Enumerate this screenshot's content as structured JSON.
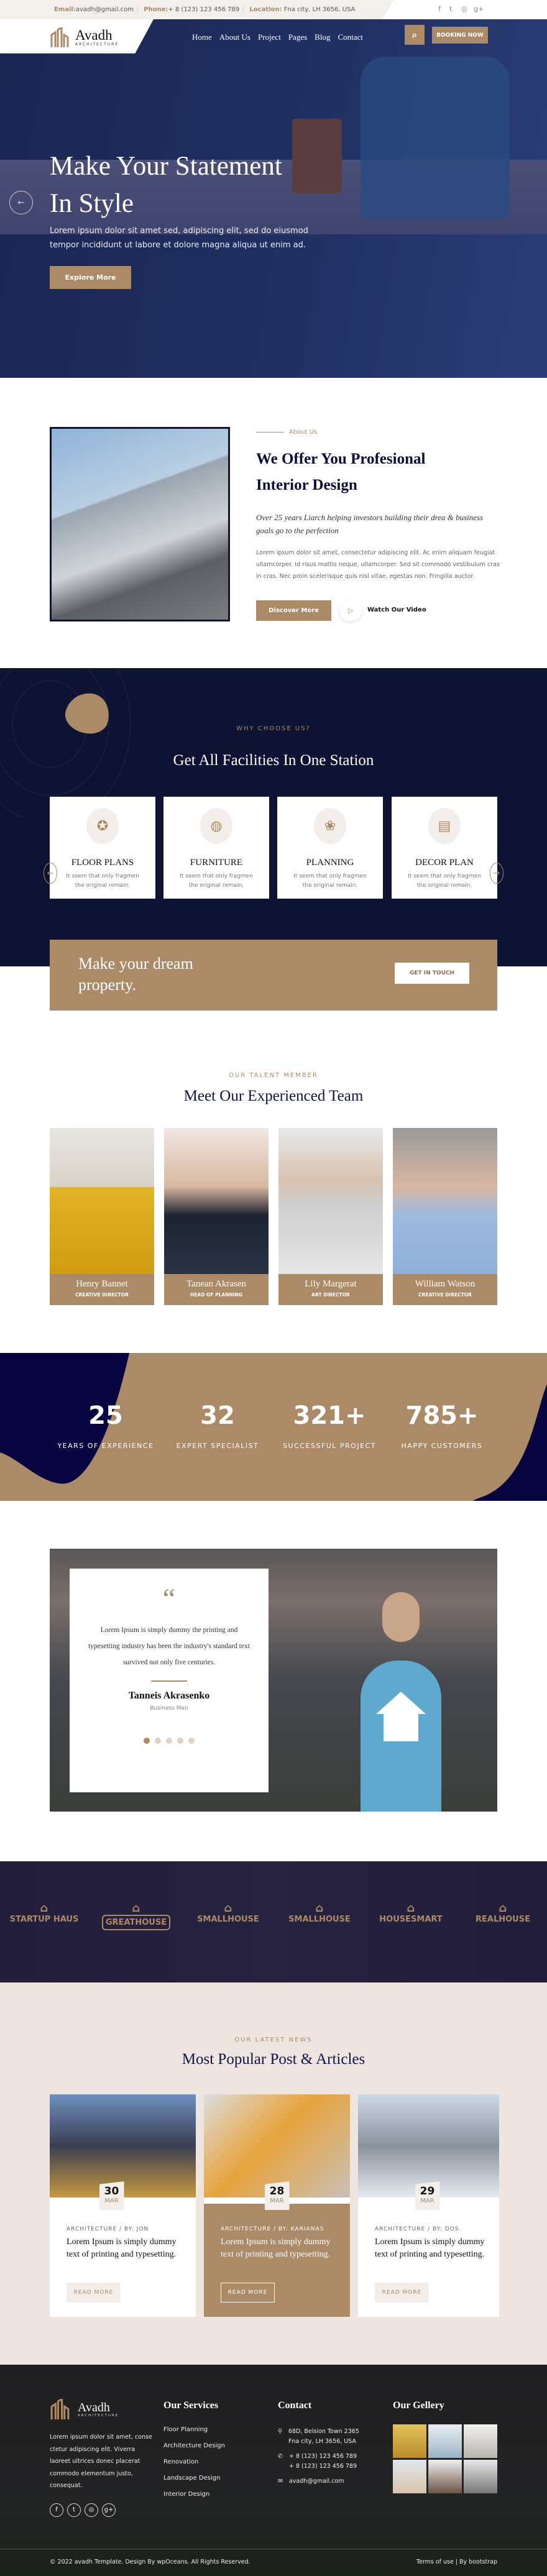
{
  "topbar": {
    "email_label": "Email:",
    "email": "avadh@gmail.com",
    "phone_label": "Phone:",
    "phone": "+ 8 (123) 123 456 789",
    "location_label": "Location:",
    "location": "Fna city, LH 3656, USA",
    "social": [
      "facebook-icon",
      "twitter-icon",
      "instagram-icon",
      "google-plus-icon"
    ]
  },
  "brand": {
    "name": "Avadh",
    "tagline": "ARCHITECTURE"
  },
  "nav": {
    "items": [
      "Home",
      "About Us",
      "Project",
      "Pages",
      "Blog",
      "Contact"
    ],
    "booking": "BOOKING NOW"
  },
  "hero": {
    "title_line1": "Make Your Statement",
    "title_line2": "In Style",
    "text": "Lorem ipsum dolor sit amet sed, adipiscing elit, sed do eiusmod tempor incididunt ut labore et dolore magna aliqua ut enim ad.",
    "button": "Explore More"
  },
  "about": {
    "label": "About Us",
    "title_line1": "We Offer You Profesional",
    "title_line2": "Interior Design",
    "subtitle": "Over 25 years Liarch helping investors building their drea & business goals go to the perfection",
    "text": "Lorem ipsum dolor sit amet, consectetur adipiscing elit. Ac enim aliquam feugiat ullamcorper. Id risus mattis neque, ullamcorper. Sed sit commodo vestibulum cras in cras. Nec proin scelerisque quis nisl vitae, egestas non. Fringilla auctor.",
    "button": "Discover More",
    "video": "Watch Our Video"
  },
  "facilities": {
    "label": "WHY CHOOSE US?",
    "title": "Get All Facilities In One Station",
    "cards": [
      {
        "title": "FLOOR PLANS",
        "text": "It seem that only fragmen the original remain.",
        "icon": "award-icon"
      },
      {
        "title": "FURNITURE",
        "text": "It seem that only fragmen the original remain.",
        "icon": "globe-hand-icon"
      },
      {
        "title": "PLANNING",
        "text": "It seem that only fragmen the original remain.",
        "icon": "lotus-hand-icon"
      },
      {
        "title": "DECOR PLAN",
        "text": "It seem that only fragmen the original remain.",
        "icon": "bed-lamp-icon"
      }
    ]
  },
  "cta": {
    "title_line1": "Make your dream",
    "title_line2": "property.",
    "button": "GET IN TOUCH"
  },
  "team": {
    "label": "OUR TALENT MEMBER",
    "title": "Meet Our Experienced Team",
    "members": [
      {
        "name": "Henry Bannet",
        "role": "CREATIVE DIRECTOR"
      },
      {
        "name": "Tanean Akrasen",
        "role": "HEAD OF PLANNING"
      },
      {
        "name": "Lily Margerat",
        "role": "ART DIRECTOR"
      },
      {
        "name": "William Watson",
        "role": "CREATIVE DIRECTOR"
      }
    ]
  },
  "stats": [
    {
      "value": "25",
      "label": "YEARS OF EXPERIENCE"
    },
    {
      "value": "32",
      "label": "EXPERT SPECIALIST"
    },
    {
      "value": "321+",
      "label": "SUCCESSFUL PROJECT"
    },
    {
      "value": "785+",
      "label": "HAPPY CUSTOMERS"
    }
  ],
  "testimonial": {
    "text": "Lorem Ipsum is simply dummy the printing and typesetting industry has been the industry's standard text survived not only five centuries.",
    "name": "Tanneis Akrasenko",
    "role": "Business Man",
    "active_slide": 1,
    "slides": 5
  },
  "brands": [
    "STARTUP HAUS",
    "GREATHOUSE",
    "SMALLHOUSE",
    "SMALLHOUSE",
    "HOUSESMART",
    "REALHOUSE"
  ],
  "blog": {
    "label": "OUR LATEST NEWS",
    "title": "Most Popular Post & Articles",
    "posts": [
      {
        "day": "30",
        "month": "MAR",
        "meta": "ARCHITECTURE / BY: JON",
        "title": "Lorem Ipsum is simply dummy text of printing and typesetting.",
        "button": "READ MORE"
      },
      {
        "day": "28",
        "month": "MAR",
        "meta": "ARCHITECTURE / BY: KARIANAS",
        "title": "Lorem Ipsum is simply dummy text of printing and typesetting.",
        "button": "READ MORE"
      },
      {
        "day": "29",
        "month": "MAR",
        "meta": "ARCHITECTURE / BY: DOS",
        "title": "Lorem Ipsum is simply dummy text of printing and typesetting.",
        "button": "READ MORE"
      }
    ]
  },
  "footer": {
    "about": "Lorem ipsum dolor sit amet, conse ctetur adipiscing elit. Viverra laoreet ultrices donec placerat commodo elementum justo, consequat.",
    "services_title": "Our Services",
    "services": [
      "Floor Planning",
      "Architecture Design",
      "Renovation",
      "Landscape Design",
      "Interior Design"
    ],
    "contact_title": "Contact",
    "address_line1": "68D, Belsion Town 2365",
    "address_line2": "Fna city, LH 3656, USA",
    "phone1": "+ 8 (123) 123 456 789",
    "phone2": "+ 8 (123) 123 456 789",
    "email": "avadh@gmail.com",
    "gallery_title": "Our Gellery",
    "copyright": "© 2022 avadh Template. Design By wpOceans. All Rights Reserved.",
    "terms": "Terms of use | By bootstrap"
  },
  "colors": {
    "accent": "#ab8a67",
    "navy": "#0e1233",
    "heading": "#111445"
  }
}
